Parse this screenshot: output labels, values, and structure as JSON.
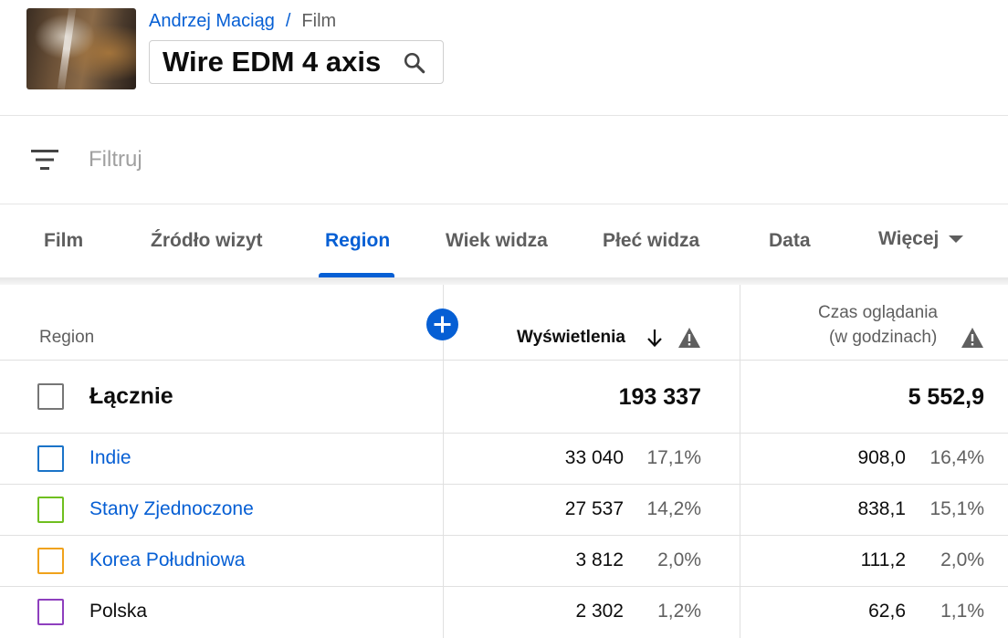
{
  "header": {
    "breadcrumb": {
      "channel": "Andrzej Maciąg",
      "separator": "/",
      "current": "Film"
    },
    "title": "Wire EDM 4 axis",
    "thumbnail_alt": "video thumbnail"
  },
  "filter": {
    "placeholder": "Filtruj",
    "icon": "filter-icon"
  },
  "tabs": [
    {
      "label": "Film",
      "active": false
    },
    {
      "label": "Źródło wizyt",
      "active": false
    },
    {
      "label": "Region",
      "active": true
    },
    {
      "label": "Wiek widza",
      "active": false
    },
    {
      "label": "Płeć widza",
      "active": false
    },
    {
      "label": "Data",
      "active": false
    }
  ],
  "more_tab": {
    "label": "Więcej",
    "icon": "caret-down-icon"
  },
  "table": {
    "columns": {
      "dimension": "Region",
      "views": "Wyświetlenia",
      "watch_time_line1": "Czas oglądania",
      "watch_time_line2": "(w godzinach)"
    },
    "total": {
      "label": "Łącznie",
      "views": "193 337",
      "watch_time": "5 552,9"
    },
    "rows": [
      {
        "label": "Indie",
        "views": "33 040",
        "views_pct": "17,1%",
        "watch_time": "908,0",
        "watch_time_pct": "16,4%",
        "color": "#1a73c8",
        "link": true
      },
      {
        "label": "Stany Zjednoczone",
        "views": "27 537",
        "views_pct": "14,2%",
        "watch_time": "838,1",
        "watch_time_pct": "15,1%",
        "color": "#6fbf1f",
        "link": true
      },
      {
        "label": "Korea Południowa",
        "views": "3 812",
        "views_pct": "2,0%",
        "watch_time": "111,2",
        "watch_time_pct": "2,0%",
        "color": "#f0a21b",
        "link": true
      },
      {
        "label": "Polska",
        "views": "2 302",
        "views_pct": "1,2%",
        "watch_time": "62,6",
        "watch_time_pct": "1,1%",
        "color": "#8e3fbe",
        "link": false
      }
    ]
  },
  "colors": {
    "accent": "#065fd4",
    "muted": "#606060"
  }
}
